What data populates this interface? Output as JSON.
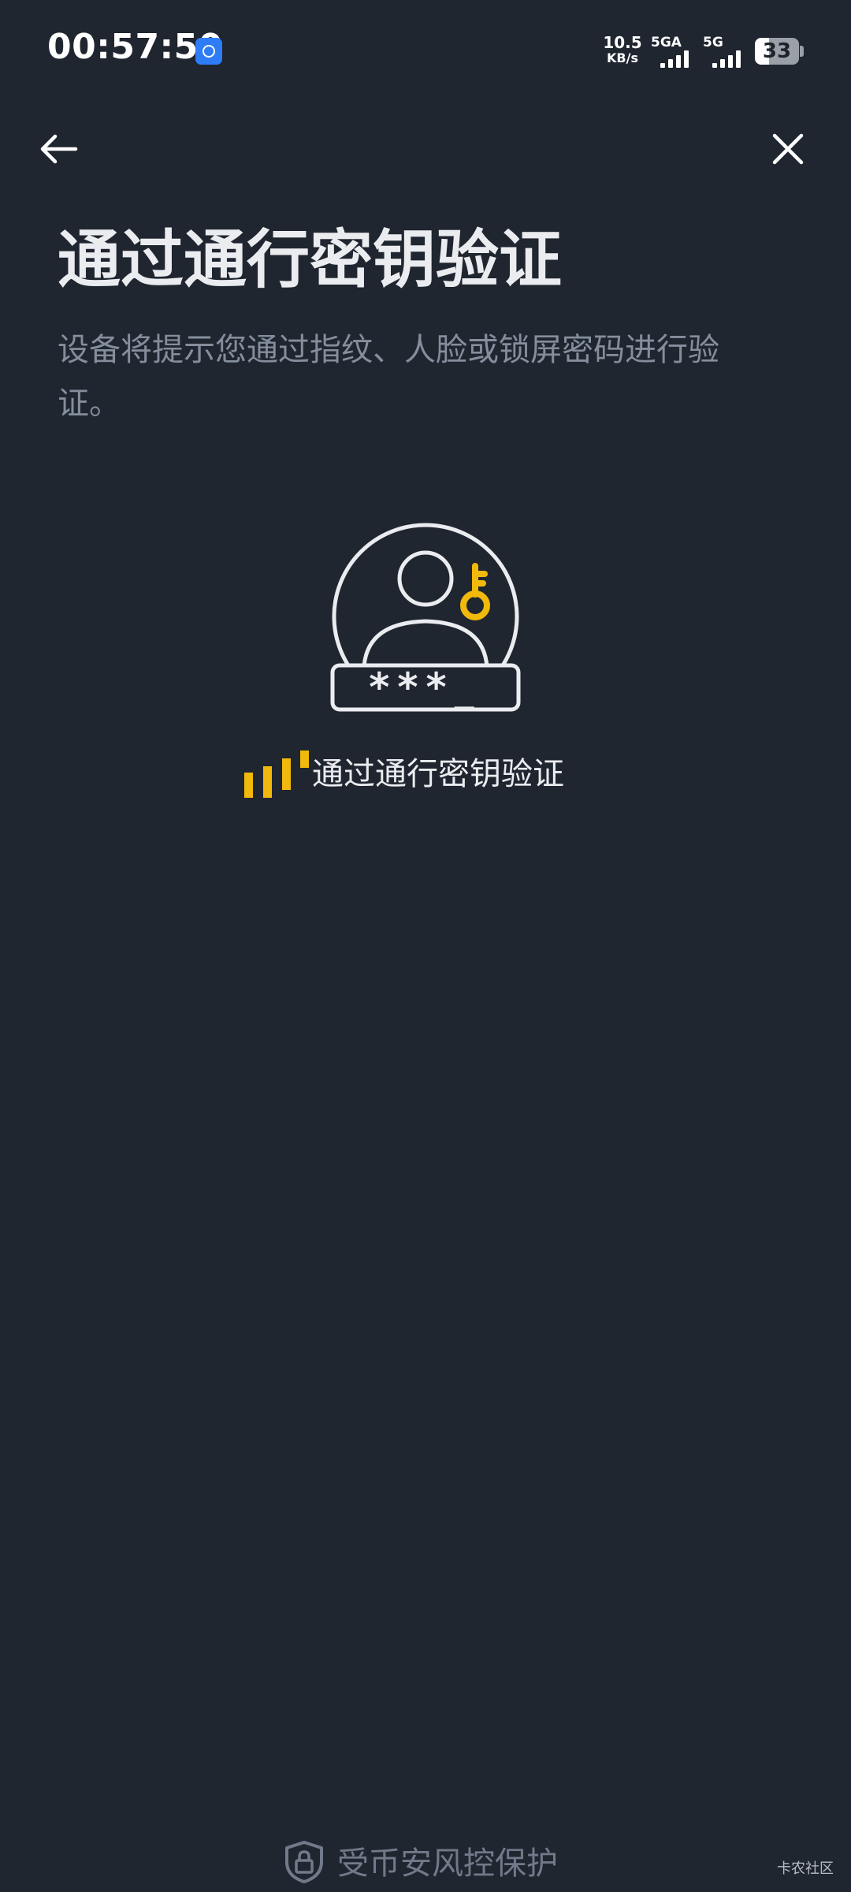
{
  "status_bar": {
    "time": "00:57:50",
    "net_speed_value": "10.5",
    "net_speed_unit": "KB/s",
    "signal_1_label": "5GA",
    "signal_2_label": "5G",
    "battery": "33",
    "battery_level": 0.33
  },
  "nav": {
    "back_icon": "arrow-left-icon",
    "close_icon": "close-icon"
  },
  "page": {
    "title": "通过通行密钥验证",
    "subtitle": "设备将提示您通过指纹、人脸或锁屏密码进行验证。",
    "passcode_mask": "***_",
    "loading_text": "通过通行密钥验证"
  },
  "footer": {
    "protection_text": "受币安风控保护",
    "watermark": "卡农社区"
  },
  "colors": {
    "background": "#202630",
    "accent": "#F0B90B",
    "title": "#EAECEF",
    "subtitle": "#848E9C",
    "footer": "#707A8A"
  }
}
